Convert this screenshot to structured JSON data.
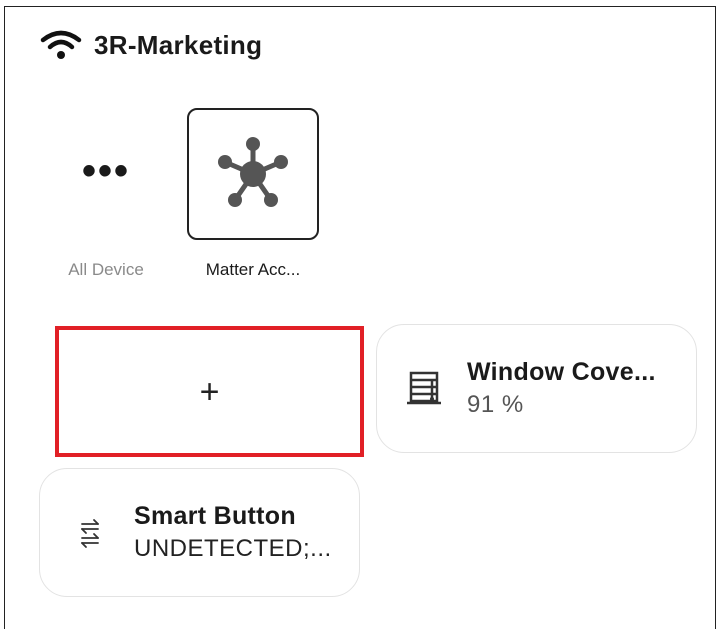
{
  "header": {
    "network_icon": "wifi-icon",
    "network_name": "3R-Marketing"
  },
  "group_tabs": [
    {
      "label": "All Device",
      "icon": "more-dots-icon",
      "selected": false
    },
    {
      "label": "Matter Acc...",
      "icon": "matter-hub-icon",
      "selected": true
    }
  ],
  "add_card": {
    "label": "+",
    "highlight_color": "#e12026"
  },
  "devices": [
    {
      "name": "Window Cove...",
      "status": "91 %",
      "icon": "window-covering-icon"
    },
    {
      "name": "Smart Button",
      "status": "UNDETECTED;...",
      "icon": "swap-arrows-icon"
    }
  ]
}
